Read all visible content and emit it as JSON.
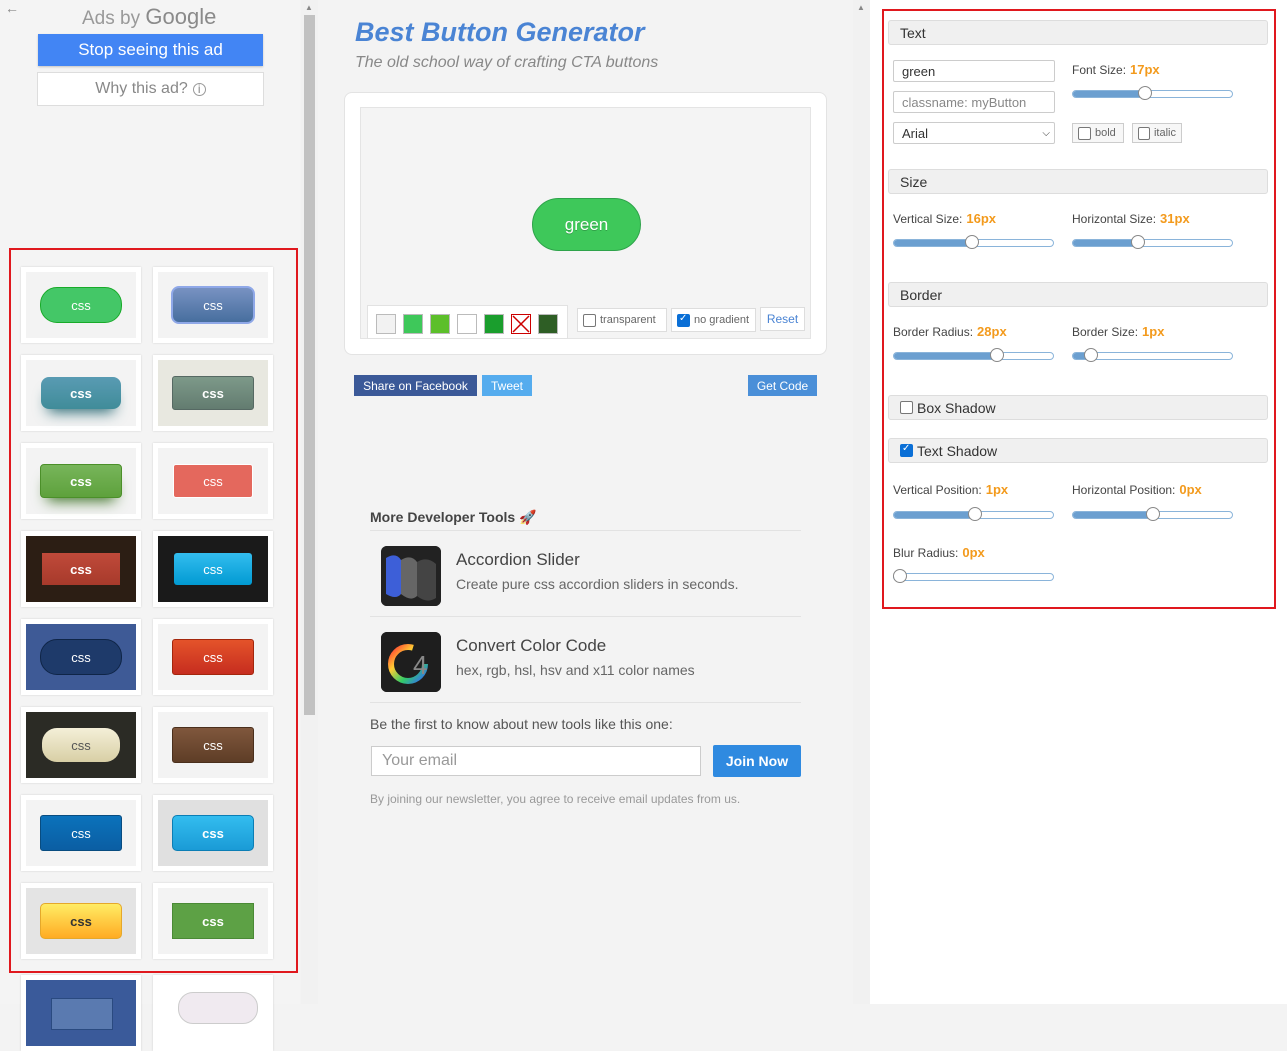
{
  "ads": {
    "back_arrow": "←",
    "ads_by": "Ads by",
    "google": "Google",
    "stop_label": "Stop seeing this ad",
    "why_label": "Why this ad?",
    "info_glyph": "i"
  },
  "gallery": {
    "tile_label": "css"
  },
  "header": {
    "title": "Best Button Generator",
    "subtitle": "The old school way of crafting CTA buttons"
  },
  "preview": {
    "button_text": "green",
    "button_color": "#3ec85a",
    "transparent_label": "transparent",
    "no_gradient_label": "no gradient",
    "reset_label": "Reset",
    "swatch_colors": [
      "#f2f2f2",
      "#3ec85a",
      "#5cbf2a",
      "#ffffff",
      "#1a9e2d",
      "none",
      "#2e5e25"
    ]
  },
  "share": {
    "facebook": "Share on Facebook",
    "tweet": "Tweet",
    "get_code": "Get Code"
  },
  "more_tools": {
    "heading": "More Developer Tools",
    "rocket": "🚀",
    "items": [
      {
        "name": "Accordion Slider",
        "desc": "Create pure css accordion sliders in seconds."
      },
      {
        "name": "Convert Color Code",
        "desc": "hex, rgb, hsl, hsv and x11 color names"
      }
    ]
  },
  "newsletter": {
    "prompt": "Be the first to know about new tools like this one:",
    "email_placeholder": "Your email",
    "join_label": "Join Now",
    "note": "By joining our newsletter, you agree to receive email updates from us."
  },
  "panel": {
    "text": {
      "heading": "Text",
      "text_value": "green",
      "classname_placeholder": "classname: myButton",
      "font_value": "Arial",
      "font_size_label": "Font Size:",
      "font_size_value": "17px",
      "font_size_level": 0.45,
      "bold_label": "bold",
      "italic_label": "italic"
    },
    "size": {
      "heading": "Size",
      "vertical_label": "Vertical Size:",
      "vertical_value": "16px",
      "vertical_level": 0.49,
      "horizontal_label": "Horizontal Size:",
      "horizontal_value": "31px",
      "horizontal_level": 0.4
    },
    "border": {
      "heading": "Border",
      "radius_label": "Border Radius:",
      "radius_value": "28px",
      "radius_level": 0.66,
      "size_label": "Border Size:",
      "size_value": "1px",
      "size_level": 0.08
    },
    "box_shadow": {
      "heading": "Box Shadow",
      "checked": false
    },
    "text_shadow": {
      "heading": "Text Shadow",
      "checked": true,
      "vpos_label": "Vertical Position:",
      "vpos_value": "1px",
      "vpos_level": 0.51,
      "hpos_label": "Horizontal Position:",
      "hpos_value": "0px",
      "hpos_level": 0.5,
      "blur_label": "Blur Radius:",
      "blur_value": "0px",
      "blur_level": 0
    }
  }
}
